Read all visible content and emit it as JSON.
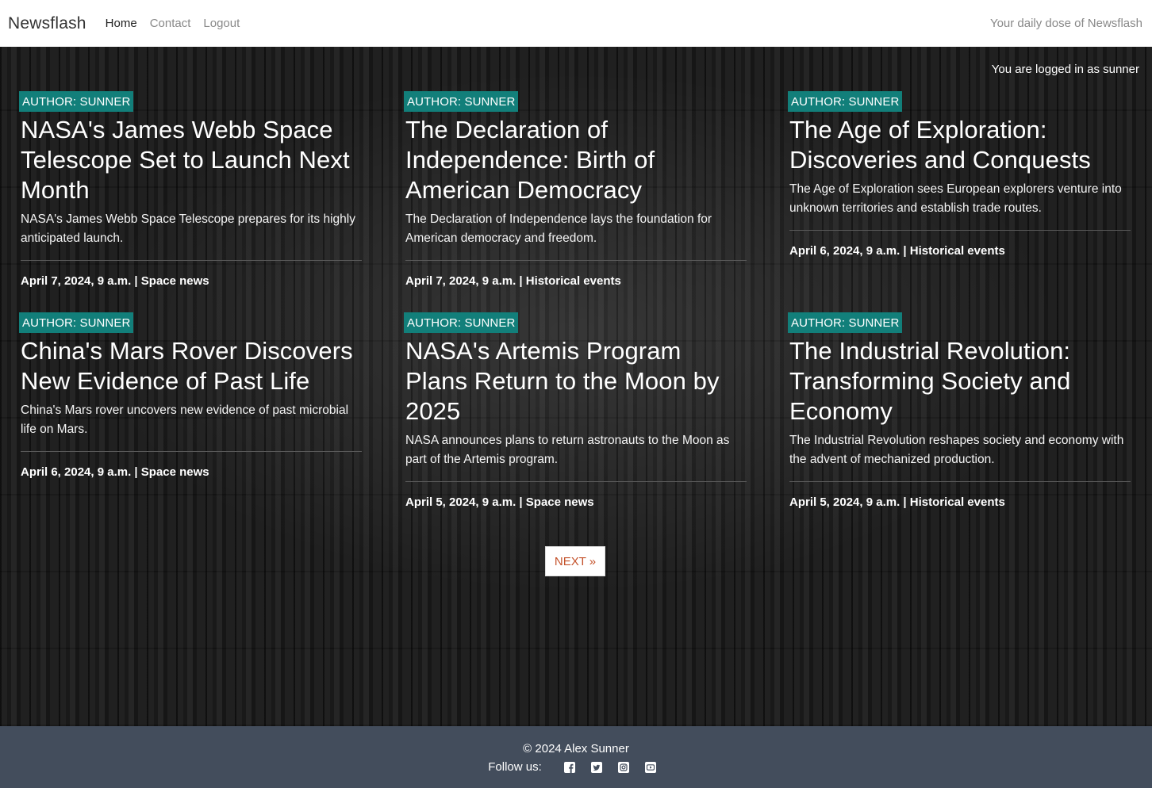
{
  "navbar": {
    "brand": "Newsflash",
    "links": [
      "Home",
      "Contact",
      "Logout"
    ],
    "tagline": "Your daily dose of Newsflash"
  },
  "login_status": "You are logged in as sunner",
  "articles": [
    {
      "author": "AUTHOR: SUNNER",
      "title": "NASA's James Webb Space Telescope Set to Launch Next Month",
      "summary": "NASA's James Webb Space Telescope prepares for its highly anticipated launch.",
      "meta": "April 7, 2024, 9 a.m. | Space news"
    },
    {
      "author": "AUTHOR: SUNNER",
      "title": "The Declaration of Independence: Birth of American Democracy",
      "summary": "The Declaration of Independence lays the foundation for American democracy and freedom.",
      "meta": "April 7, 2024, 9 a.m. | Historical events"
    },
    {
      "author": "AUTHOR: SUNNER",
      "title": "The Age of Exploration: Discoveries and Conquests",
      "summary": "The Age of Exploration sees European explorers venture into unknown territories and establish trade routes.",
      "meta": "April 6, 2024, 9 a.m. | Historical events"
    },
    {
      "author": "AUTHOR: SUNNER",
      "title": "China's Mars Rover Discovers New Evidence of Past Life",
      "summary": "China's Mars rover uncovers new evidence of past microbial life on Mars.",
      "meta": "April 6, 2024, 9 a.m. | Space news"
    },
    {
      "author": "AUTHOR: SUNNER",
      "title": "NASA's Artemis Program Plans Return to the Moon by 2025",
      "summary": "NASA announces plans to return astronauts to the Moon as part of the Artemis program.",
      "meta": "April 5, 2024, 9 a.m. | Space news"
    },
    {
      "author": "AUTHOR: SUNNER",
      "title": "The Industrial Revolution: Transforming Society and Economy",
      "summary": "The Industrial Revolution reshapes society and economy with the advent of mechanized production.",
      "meta": "April 5, 2024, 9 a.m. | Historical events"
    }
  ],
  "pagination": {
    "next_label": "NEXT »"
  },
  "footer": {
    "copyright": "© 2024 Alex Sunner",
    "follow_label": "Follow us:",
    "social_icons": [
      "facebook-icon",
      "twitter-icon",
      "instagram-icon",
      "youtube-icon"
    ]
  }
}
